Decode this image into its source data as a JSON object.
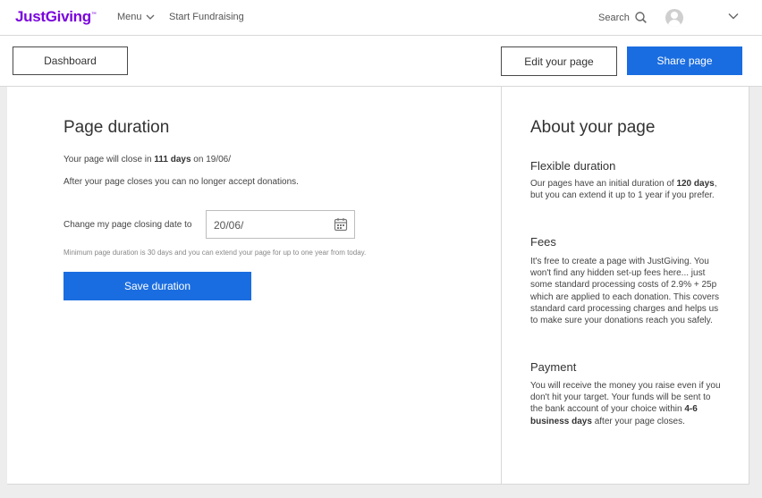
{
  "header": {
    "logo": "JustGiving",
    "logo_tm": "™",
    "menu_label": "Menu",
    "start_fundraising": "Start Fundraising",
    "search_label": "Search"
  },
  "actions": {
    "dashboard": "Dashboard",
    "edit_page": "Edit your page",
    "share_page": "Share page"
  },
  "main": {
    "title": "Page duration",
    "close_prefix": "Your page will close in ",
    "close_days": "111 days",
    "close_suffix": " on 19/06/",
    "after_text": "After your page closes you can no longer accept donations.",
    "change_label": "Change my page closing date to",
    "date_value": "20/06/",
    "hint": "Minimum page duration is 30 days and you can extend your page for up to one year from today.",
    "save_button": "Save duration"
  },
  "about": {
    "title": "About your page",
    "flexible": {
      "heading": "Flexible duration",
      "text1": "Our pages have an initial duration of ",
      "bold": "120 days",
      "text2": ", but you can extend it up to 1 year if you prefer."
    },
    "fees": {
      "heading": "Fees",
      "text": "It's free to create a page with JustGiving. You won't find any hidden set-up fees here... just some standard processing costs of 2.9% + 25p which are applied to each donation. This covers standard card processing charges and helps us to make sure your donations reach you safely."
    },
    "payment": {
      "heading": "Payment",
      "text1": "You will receive the money you raise even if you don't hit your target. Your funds will be sent to the bank account of your choice within ",
      "bold": "4-6 business days",
      "text2": " after your page closes."
    }
  },
  "colors": {
    "brand": "#7a04dd",
    "primary_button": "#1a6de0",
    "background": "#ededed"
  },
  "icons": [
    "chevron-down-icon",
    "search-icon",
    "avatar-icon",
    "calendar-icon"
  ]
}
